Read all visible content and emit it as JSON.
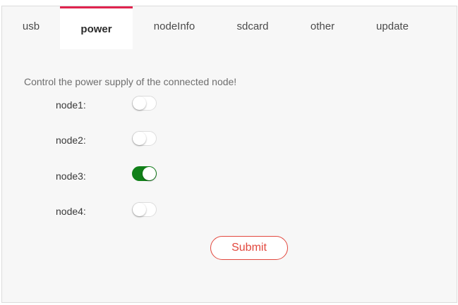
{
  "tabs": {
    "usb": "usb",
    "power": "power",
    "nodeinfo": "nodeInfo",
    "sdcard": "sdcard",
    "other": "other",
    "update": "update"
  },
  "active_tab": "power",
  "power": {
    "description": "Control the power supply of the connected node!",
    "nodes": [
      {
        "label": "node1:",
        "on": false
      },
      {
        "label": "node2:",
        "on": false
      },
      {
        "label": "node3:",
        "on": true
      },
      {
        "label": "node4:",
        "on": false
      }
    ],
    "submit_label": "Submit"
  },
  "colors": {
    "accent": "#e0234e",
    "switch_on": "#118019",
    "submit": "#e2473d"
  }
}
